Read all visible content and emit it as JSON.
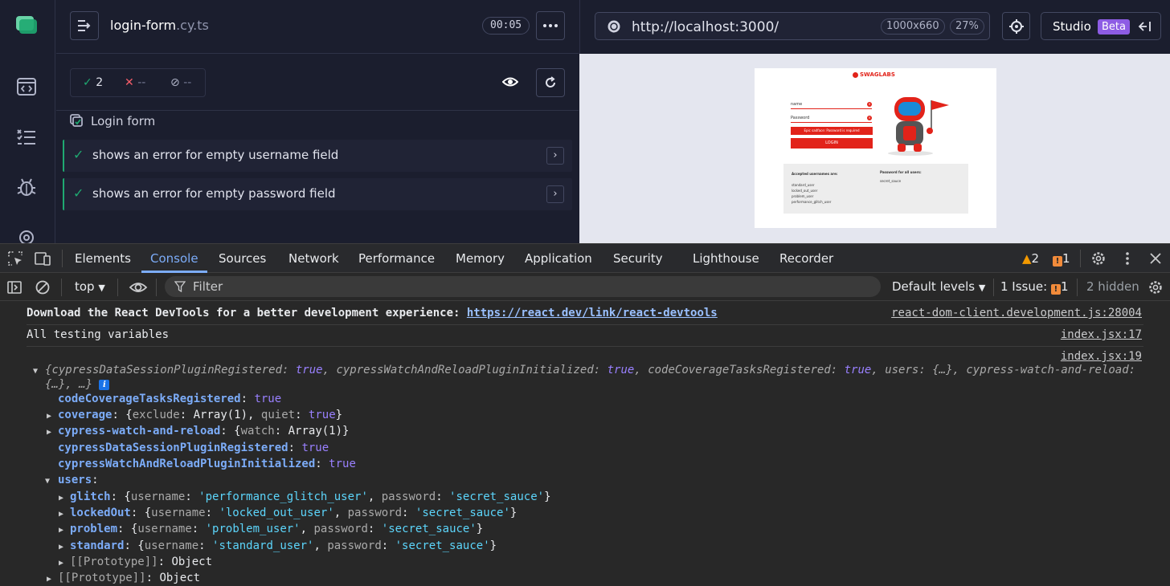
{
  "runner": {
    "spec_name": "login-form",
    "spec_ext": ".cy.ts",
    "timer": "00:05",
    "stats": {
      "passed": "2",
      "failed": "--",
      "pending": "--"
    },
    "suite_title": "Login form",
    "tests": [
      {
        "title": "shows an error for empty username field"
      },
      {
        "title": "shows an error for empty password field"
      }
    ]
  },
  "aut": {
    "url": "http://localhost:3000/",
    "viewport": "1000x660",
    "zoom": "27%",
    "studio_label": "Studio",
    "beta_label": "Beta"
  },
  "swaglabs": {
    "logo_text": "SWAGLABS",
    "username_placeholder": "name",
    "password_placeholder": "Password",
    "error_text": "Epic sadface: Password is required",
    "login_label": "LOGIN",
    "accepted_title": "Accepted usernames are:",
    "usernames": [
      "standard_user",
      "locked_out_user",
      "problem_user",
      "performance_glitch_user"
    ],
    "password_title": "Password for all users:",
    "password_value": "secret_sauce"
  },
  "devtools": {
    "tabs": [
      "Elements",
      "Console",
      "Sources",
      "Network",
      "Performance",
      "Memory",
      "Application",
      "Security",
      "Lighthouse",
      "Recorder"
    ],
    "active_tab": "Console",
    "warnings_count": "2",
    "issues_count": "1",
    "context": "top",
    "filter_placeholder": "Filter",
    "levels": "Default levels",
    "issue_label": "1 Issue:",
    "issue_count_badge": "1",
    "hidden_label": "2 hidden"
  },
  "console": {
    "msg1_text": "Download the React DevTools for a better development experience: ",
    "msg1_link": "https://react.dev/link/react-devtools",
    "msg1_src": "react-dom-client.development.js:28004",
    "msg2_text": "All testing variables",
    "msg2_src": "index.jsx:17",
    "msg3_src": "index.jsx:19",
    "summary_line1": [
      "cypressDataSessionPluginRegistered",
      "true",
      "cypressWatchAndReloadPluginInitialized",
      "true",
      "codeCoverageTasksRegistered",
      "true",
      "users",
      "{…}",
      "cypress-watch-and-reload",
      ""
    ],
    "summary_line2": "{…}, …}",
    "props": {
      "codeCoverageTasksRegistered": {
        "key": "codeCoverageTasksRegistered",
        "value": "true"
      },
      "coverage": {
        "key": "coverage",
        "exclude_key": "exclude",
        "exclude_val": "Array(1)",
        "quiet_key": "quiet",
        "quiet_val": "true"
      },
      "cwr": {
        "key": "cypress-watch-and-reload",
        "watch_key": "watch",
        "watch_val": "Array(1)"
      },
      "cdsp": {
        "key": "cypressDataSessionPluginRegistered",
        "value": "true"
      },
      "cwrpi": {
        "key": "cypressWatchAndReloadPluginInitialized",
        "value": "true"
      },
      "users_key": "users",
      "users": [
        {
          "key": "glitch",
          "username": "'performance_glitch_user'",
          "password": "'secret_sauce'"
        },
        {
          "key": "lockedOut",
          "username": "'locked_out_user'",
          "password": "'secret_sauce'"
        },
        {
          "key": "problem",
          "username": "'problem_user'",
          "password": "'secret_sauce'"
        },
        {
          "key": "standard",
          "username": "'standard_user'",
          "password": "'secret_sauce'"
        }
      ],
      "proto_label": "[[Prototype]]",
      "proto_value": "Object"
    },
    "username_key": "username",
    "password_key": "password"
  },
  "colors": {
    "pass": "#1fa971",
    "fail": "#f55d69",
    "brand_red": "#e2231a",
    "devtools_accent": "#7cacf8",
    "beta": "#8d5ce4"
  }
}
